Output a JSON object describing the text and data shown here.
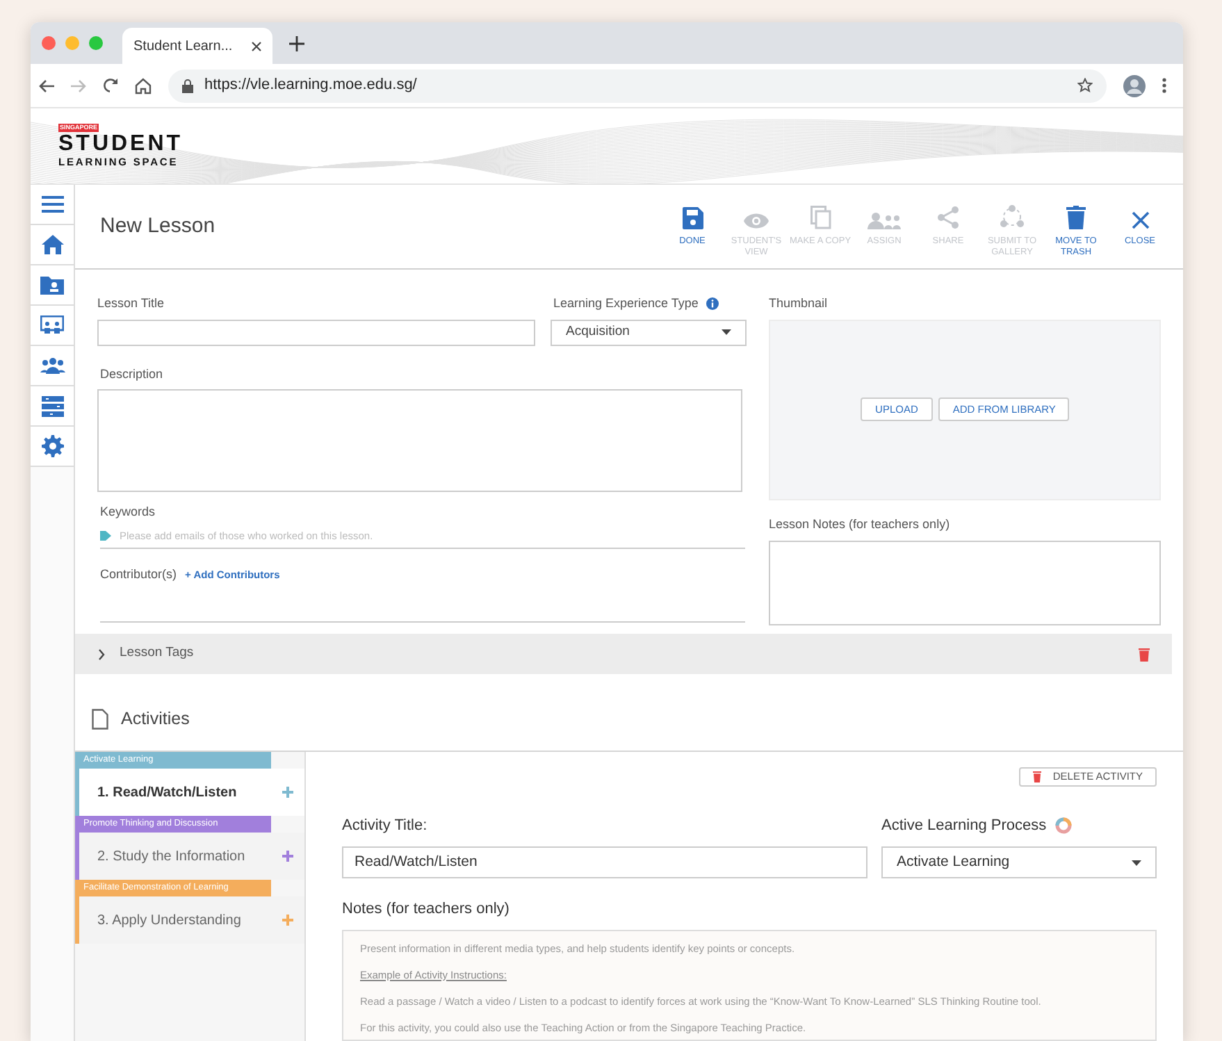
{
  "browser": {
    "tab_title": "Student Learn...",
    "url": "https://vle.learning.moe.edu.sg/"
  },
  "logo": {
    "badge": "SINGAPORE",
    "title": "STUDENT",
    "subtitle": "LEARNING SPACE"
  },
  "sidebar": {
    "items": [
      {
        "kind": "menu"
      },
      {
        "kind": "home"
      },
      {
        "kind": "folder"
      },
      {
        "kind": "screen"
      },
      {
        "kind": "group"
      },
      {
        "kind": "list"
      },
      {
        "kind": "gear"
      }
    ]
  },
  "page": {
    "title": "New Lesson"
  },
  "toolbar": [
    {
      "kind": "save",
      "label": "DONE",
      "disabled": false
    },
    {
      "kind": "eye",
      "label": "STUDENT'S VIEW",
      "disabled": true
    },
    {
      "kind": "copy",
      "label": "MAKE A COPY",
      "disabled": true
    },
    {
      "kind": "people",
      "label": "ASSIGN",
      "disabled": true
    },
    {
      "kind": "share",
      "label": "SHARE",
      "disabled": true
    },
    {
      "kind": "network",
      "label": "SUBMIT TO GALLERY",
      "disabled": true
    },
    {
      "kind": "trash",
      "label": "MOVE TO TRASH",
      "disabled": false
    },
    {
      "kind": "close",
      "label": "CLOSE",
      "disabled": false
    }
  ],
  "form": {
    "lesson_title_label": "Lesson Title",
    "lxt_label": "Learning Experience Type",
    "lxt_value": "Acquisition",
    "description_label": "Description",
    "keywords_label": "Keywords",
    "keywords_placeholder": "Please add emails of those who worked on this lesson.",
    "contributors_label": "Contributor(s)",
    "add_contributors": "+ Add Contributors",
    "thumbnail_label": "Thumbnail",
    "upload": "UPLOAD",
    "add_from_library": "ADD FROM LIBRARY",
    "lesson_notes_label": "Lesson Notes (for teachers only)"
  },
  "lesson_tags": {
    "label": "Lesson Tags",
    "expanded": false
  },
  "activities": {
    "title": "Activities",
    "items": [
      {
        "category": "Activate Learning",
        "color": "#7fbad0",
        "title": "1. Read/Watch/Listen",
        "selected": true
      },
      {
        "category": "Promote Thinking and Discussion",
        "color": "#a17fdc",
        "title": "2. Study the Information",
        "selected": false
      },
      {
        "category": "Facilitate Demonstration of Learning",
        "color": "#f4ad5c",
        "title": "3. Apply Understanding",
        "selected": false
      }
    ]
  },
  "activity": {
    "delete": "DELETE ACTIVITY",
    "title_label": "Activity Title:",
    "title_value": "Read/Watch/Listen",
    "process_label": "Active Learning Process",
    "process_value": "Activate Learning",
    "notes_label": "Notes (for teachers only)",
    "notes": [
      {
        "kind": "text",
        "text": "Present information in different media types, and help students identify key points or concepts."
      },
      {
        "kind": "heading",
        "text": "Example of Activity Instructions:"
      },
      {
        "kind": "text",
        "text": "Read a passage / Watch a video / Listen to a podcast to identify forces at work using the “Know-Want To Know-Learned” SLS Thinking Routine tool."
      },
      {
        "kind": "text",
        "text": "For this activity, you could also use the Teaching Action or from the Singapore Teaching Practice."
      }
    ]
  }
}
